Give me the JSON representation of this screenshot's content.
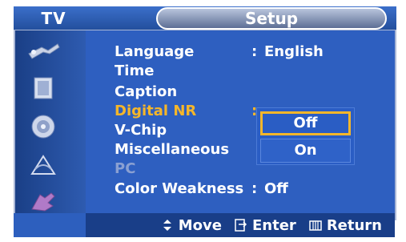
{
  "header": {
    "tv_label": "TV",
    "menu_title": "Setup"
  },
  "menu": {
    "items": [
      {
        "label": "Language",
        "value": "English",
        "state": "normal"
      },
      {
        "label": "Time",
        "value": "",
        "state": "normal"
      },
      {
        "label": "Caption",
        "value": "",
        "state": "normal"
      },
      {
        "label": "Digital NR",
        "value": "",
        "state": "active"
      },
      {
        "label": "V-Chip",
        "value": "",
        "state": "normal"
      },
      {
        "label": "Miscellaneous",
        "value": "",
        "state": "normal"
      },
      {
        "label": "PC",
        "value": "",
        "state": "disabled"
      },
      {
        "label": "Color Weakness",
        "value": "Off",
        "state": "normal"
      }
    ],
    "colon": ":"
  },
  "dropdown": {
    "options": [
      "Off",
      "On"
    ],
    "selected": "Off"
  },
  "sidebar_icons": [
    "input-icon",
    "picture-icon",
    "sound-icon",
    "channel-icon",
    "setup-icon"
  ],
  "help": {
    "move": "Move",
    "enter": "Enter",
    "return": "Return"
  },
  "colors": {
    "background": "#1f56b1",
    "content": "#2e5fc0",
    "active_text": "#f5b62a",
    "disabled_text": "#8aa0d2"
  }
}
